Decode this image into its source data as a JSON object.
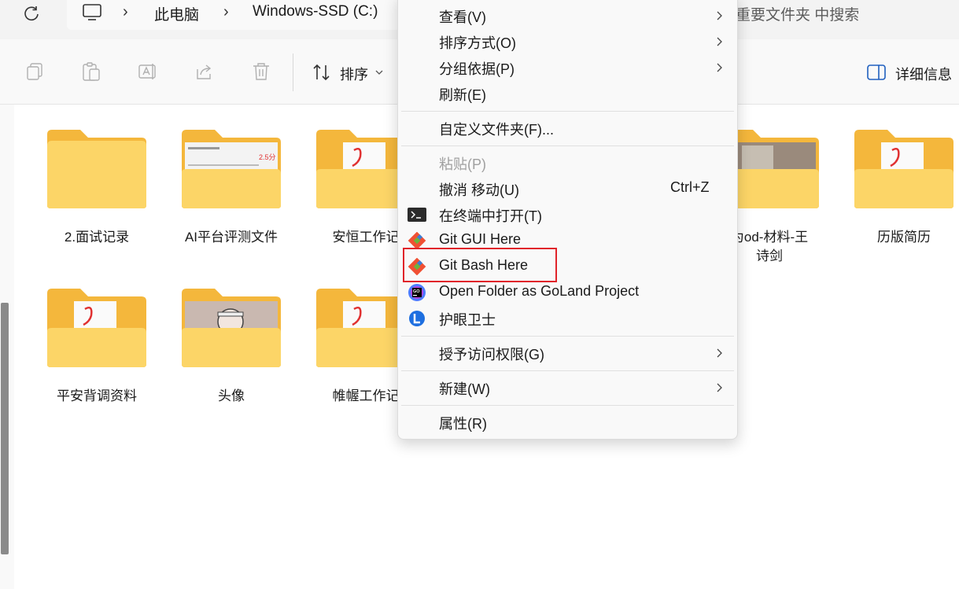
{
  "address": {
    "crumbs": [
      "此电脑",
      "Windows-SSD (C:)"
    ],
    "search_placeholder": "重要文件夹 中搜索"
  },
  "toolbar": {
    "sort_label": "排序",
    "details_label": "详细信息"
  },
  "folders": [
    {
      "label": "2.面试记录"
    },
    {
      "label": "AI平台评测文件"
    },
    {
      "label": "安恒工作记"
    },
    {
      "label_line1": "为od-材料-王",
      "label_line2": "诗剑"
    },
    {
      "label": "历版简历"
    },
    {
      "label": "平安背调资料"
    },
    {
      "label": "头像"
    },
    {
      "label": "帷幄工作记"
    }
  ],
  "folder_preview_text": {
    "score": "2.5分"
  },
  "context_menu": {
    "view": "查看(V)",
    "sort_by": "排序方式(O)",
    "group_by": "分组依据(P)",
    "refresh": "刷新(E)",
    "customize": "自定义文件夹(F)...",
    "paste": "粘贴(P)",
    "undo_move": "撤消 移动(U)",
    "undo_shortcut": "Ctrl+Z",
    "open_terminal": "在终端中打开(T)",
    "git_gui": "Git GUI Here",
    "git_bash": "Git Bash Here",
    "goland": "Open Folder as GoLand Project",
    "eye_guard": "护眼卫士",
    "give_access": "授予访问权限(G)",
    "new": "新建(W)",
    "properties": "属性(R)"
  },
  "colors": {
    "folder_back": "#f4b73c",
    "folder_front": "#fcd567",
    "highlight": "#e0242a",
    "git": "#f05033"
  }
}
